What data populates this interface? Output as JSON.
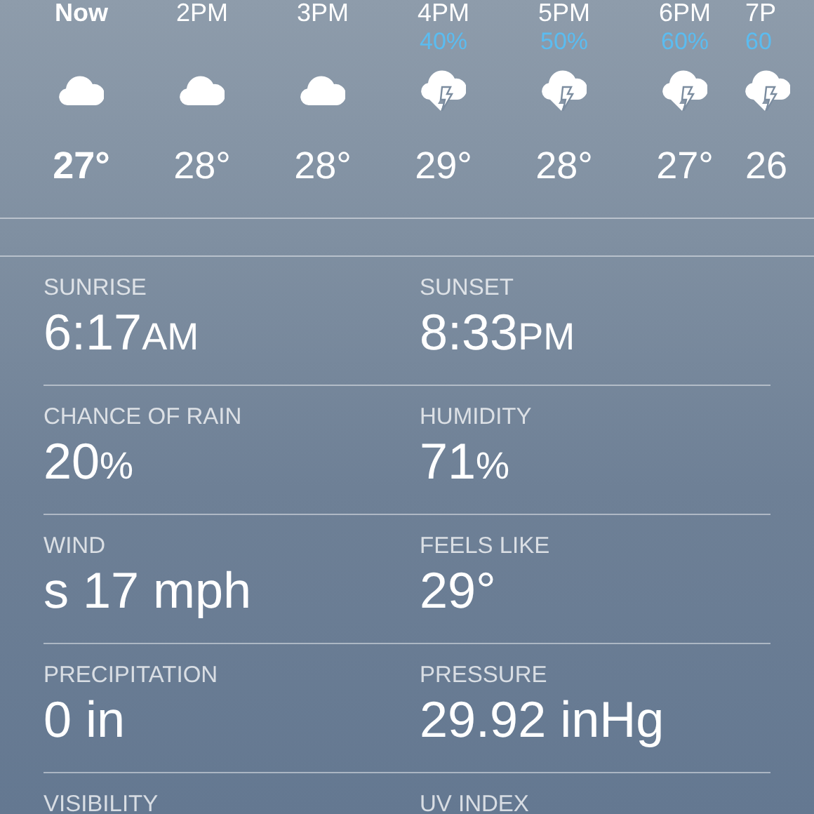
{
  "hourly": [
    {
      "time": "Now",
      "kind": "cloud",
      "temp": "27°",
      "current": true
    },
    {
      "time": "2PM",
      "kind": "cloud",
      "temp": "28°",
      "current": false
    },
    {
      "time": "3PM",
      "kind": "cloud",
      "temp": "28°",
      "current": false
    },
    {
      "time": "4PM",
      "chance": "40%",
      "kind": "thunderstorm",
      "temp": "29°",
      "current": false
    },
    {
      "time": "5PM",
      "chance": "50%",
      "kind": "thunderstorm",
      "temp": "28°",
      "current": false
    },
    {
      "time": "6PM",
      "chance": "60%",
      "kind": "thunderstorm",
      "temp": "27°",
      "current": false
    },
    {
      "time": "7P",
      "chance": "60",
      "kind": "thunderstorm",
      "temp": "26",
      "current": false
    }
  ],
  "details": [
    {
      "label": "SUNRISE",
      "value": "6:17",
      "unit": "AM"
    },
    {
      "label": "SUNSET",
      "value": "8:33",
      "unit": "PM"
    },
    {
      "label": "CHANCE OF RAIN",
      "value": "20",
      "unit": "%"
    },
    {
      "label": "HUMIDITY",
      "value": "71",
      "unit": "%"
    },
    {
      "label": "WIND",
      "value": "s 17 mph"
    },
    {
      "label": "FEELS LIKE",
      "value": "29°"
    },
    {
      "label": "PRECIPITATION",
      "value": "0 in"
    },
    {
      "label": "PRESSURE",
      "value": "29.92 inHg"
    },
    {
      "label": "VISIBILITY"
    },
    {
      "label": "UV INDEX"
    }
  ]
}
